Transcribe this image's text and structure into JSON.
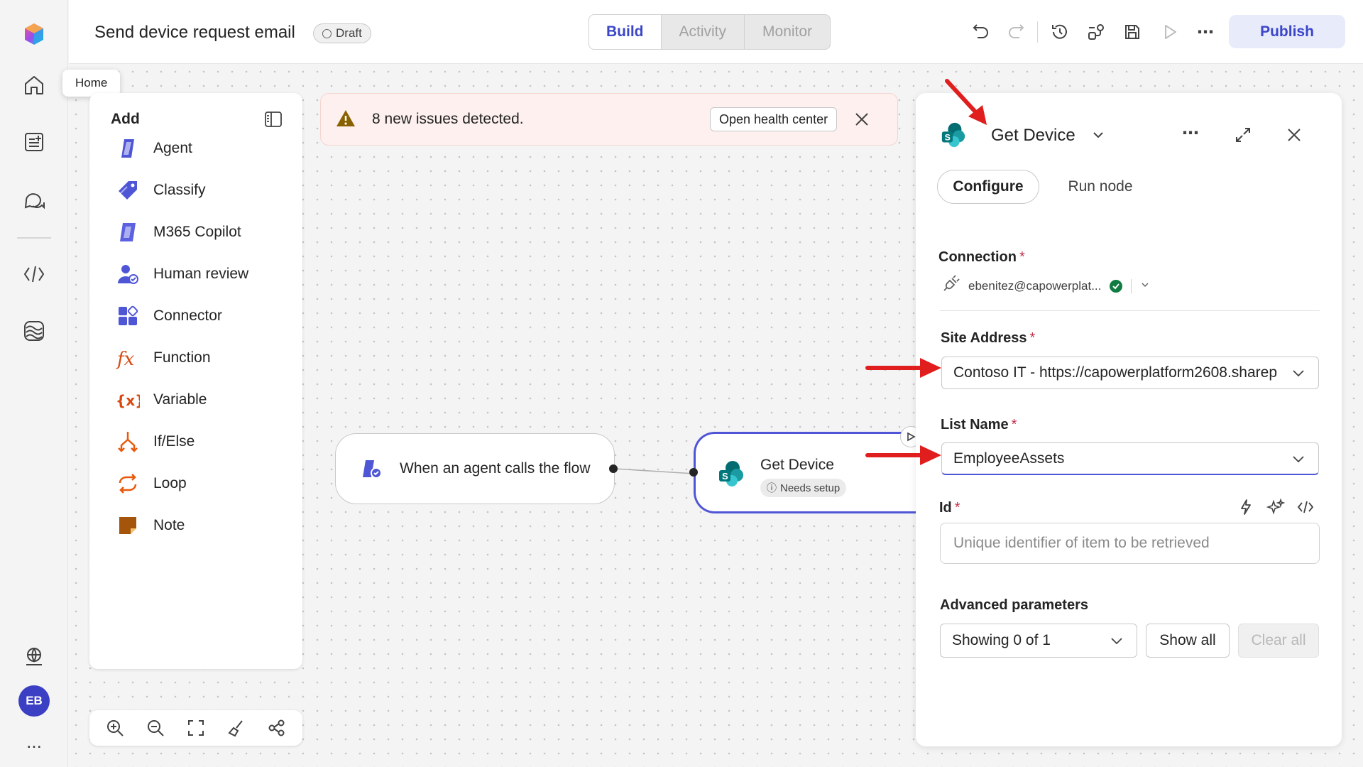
{
  "colors": {
    "accent": "#3b46c8",
    "node_border": "#4f56d6",
    "annotation": "#e01e1e",
    "warning": "#8a6100",
    "success": "#107c41",
    "avatar_bg": "#3b3fc4"
  },
  "rail": {
    "items": [
      {
        "icon": "app-logo-icon"
      },
      {
        "icon": "home-icon",
        "tooltip": "Home"
      },
      {
        "icon": "new-document-icon"
      },
      {
        "icon": "chat-icon"
      },
      {
        "icon": "code-icon"
      },
      {
        "icon": "wave-icon"
      },
      {
        "icon": "globe-icon"
      }
    ],
    "tooltip": "Home",
    "avatar_initials": "EB",
    "more": "..."
  },
  "header": {
    "title": "Send device request email",
    "badge": "Draft",
    "tabs": [
      {
        "label": "Build",
        "active": true
      },
      {
        "label": "Activity",
        "active": false
      },
      {
        "label": "Monitor",
        "active": false
      }
    ],
    "toolbar_icons": [
      "undo-icon",
      "redo-icon",
      "history-icon",
      "flow-checker-icon",
      "save-icon",
      "play-icon",
      "more-icon"
    ],
    "publish_label": "Publish"
  },
  "add_panel": {
    "title": "Add",
    "items": [
      {
        "label": "Agent",
        "icon": "agent-icon"
      },
      {
        "label": "Classify",
        "icon": "classify-icon"
      },
      {
        "label": "M365 Copilot",
        "icon": "copilot-icon"
      },
      {
        "label": "Human review",
        "icon": "human-review-icon"
      },
      {
        "label": "Connector",
        "icon": "connector-icon"
      },
      {
        "label": "Function",
        "icon": "function-icon"
      },
      {
        "label": "Variable",
        "icon": "variable-icon"
      },
      {
        "label": "If/Else",
        "icon": "if-else-icon"
      },
      {
        "label": "Loop",
        "icon": "loop-icon"
      },
      {
        "label": "Note",
        "icon": "note-icon"
      }
    ]
  },
  "zoom_bar": {
    "icons": [
      "zoom-in-icon",
      "zoom-out-icon",
      "fit-view-icon",
      "tidy-icon",
      "minimap-icon"
    ]
  },
  "banner": {
    "message": "8 new issues detected.",
    "button": "Open health center"
  },
  "nodes": {
    "trigger": {
      "label": "When an agent calls the flow"
    },
    "action": {
      "label": "Get Device",
      "status": "Needs setup"
    }
  },
  "panel": {
    "title": "Get Device",
    "tabs": [
      {
        "label": "Configure",
        "active": true
      },
      {
        "label": "Run node",
        "active": false
      }
    ],
    "connection": {
      "label": "Connection",
      "required": "*",
      "account": "ebenitez@capowerplat..."
    },
    "site_address": {
      "label": "Site Address",
      "required": "*",
      "value": "Contoso IT - https://capowerplatform2608.sharep"
    },
    "list_name": {
      "label": "List Name",
      "required": "*",
      "value": "EmployeeAssets"
    },
    "id_field": {
      "label": "Id",
      "required": "*",
      "placeholder": "Unique identifier of item to be retrieved"
    },
    "advanced": {
      "label": "Advanced parameters",
      "showing": "Showing 0 of 1",
      "show_all": "Show all",
      "clear_all": "Clear all"
    }
  }
}
